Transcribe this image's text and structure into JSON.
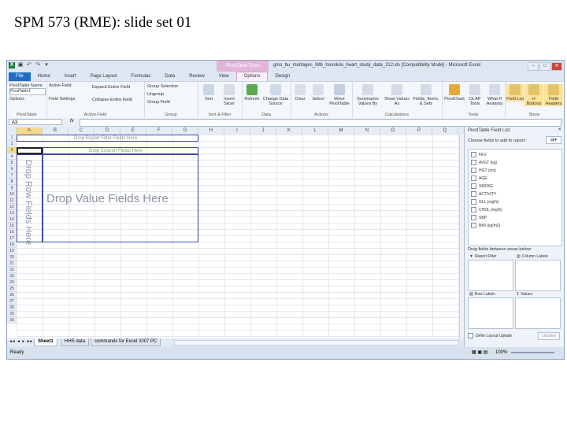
{
  "slide": {
    "title": "SPM 573 (RME): slide set 01"
  },
  "window": {
    "title": "gms_bu_mortages_IMb_honolulu_heart_study_data_212.xls [Compatibility Mode] - Microsoft Excel",
    "contextual_tab": "PivotTable Tools",
    "tabs": [
      "File",
      "Home",
      "Insert",
      "Page Layout",
      "Formulas",
      "Data",
      "Review",
      "View",
      "Options",
      "Design"
    ]
  },
  "ribbon": {
    "pivottable": {
      "name_label": "PivotTable Name:",
      "name_value": "PivotTable1",
      "options": "Options",
      "group": "PivotTable"
    },
    "active_field": {
      "label": "Active Field:",
      "field_settings": "Field Settings",
      "expand": "Expand Entire Field",
      "collapse": "Collapse Entire Field",
      "group": "Active Field"
    },
    "group": {
      "selection": "Group Selection",
      "ungroup": "Ungroup",
      "group_field": "Group Field",
      "group": "Group"
    },
    "sort": {
      "sort": "Sort",
      "insert_slicer": "Insert Slicer",
      "group": "Sort & Filter"
    },
    "data": {
      "refresh": "Refresh",
      "change_source": "Change Data Source",
      "group": "Data"
    },
    "actions": {
      "clear": "Clear",
      "select": "Select",
      "move": "Move PivotTable",
      "group": "Actions"
    },
    "calculations": {
      "summarize": "Summarize Values By",
      "show_values": "Show Values As",
      "fields_items": "Fields, Items, & Sets",
      "group": "Calculations"
    },
    "tools": {
      "pivotchart": "PivotChart",
      "olap": "OLAP Tools",
      "whatif": "What-If Analysis",
      "group": "Tools"
    },
    "show": {
      "field_list": "Field List",
      "buttons": "+/- Buttons",
      "headers": "Field Headers",
      "group": "Show"
    }
  },
  "formula_bar": {
    "namebox": "A3",
    "fx": "fx",
    "value": ""
  },
  "grid": {
    "columns": [
      "A",
      "B",
      "C",
      "D",
      "E",
      "F",
      "G",
      "H",
      "I",
      "J",
      "K",
      "L",
      "M",
      "N",
      "O",
      "P",
      "Q"
    ],
    "rows": [
      "1",
      "2",
      "3",
      "4",
      "5",
      "6",
      "7",
      "8",
      "9",
      "10",
      "11",
      "12",
      "13",
      "14",
      "15",
      "16",
      "17",
      "18",
      "19",
      "20",
      "21",
      "22",
      "23",
      "24",
      "25",
      "26",
      "27",
      "28",
      "29",
      "30"
    ],
    "pivot": {
      "report_filter": "Drop Report Filter Fields Here",
      "column_fields": "Drop Column Fields Here",
      "row_fields": "Drop Row Fields Here",
      "value_fields": "Drop Value Fields Here"
    }
  },
  "sheet_tabs": [
    "Sheet1",
    "HHS data",
    "commands for Excel 2007 PC"
  ],
  "status": {
    "ready": "Ready",
    "zoom": "100%"
  },
  "field_list": {
    "title": "PivotTable Field List",
    "choose": "Choose fields to add to report:",
    "fields": [
      "FEV",
      "AVGT (kg)",
      "HGT (cm)",
      "AGE",
      "SMOKE",
      "ACTIVITY",
      "GLL (mg%)",
      "CHOL (mg%)",
      "SBP",
      "BMI (kg/m2)"
    ],
    "drag_label": "Drag fields between areas below:",
    "areas": {
      "report_filter": "Report Filter",
      "column_labels": "Column Labels",
      "row_labels": "Row Labels",
      "values": "Values"
    },
    "defer": "Defer Layout Update",
    "update": "Update"
  }
}
